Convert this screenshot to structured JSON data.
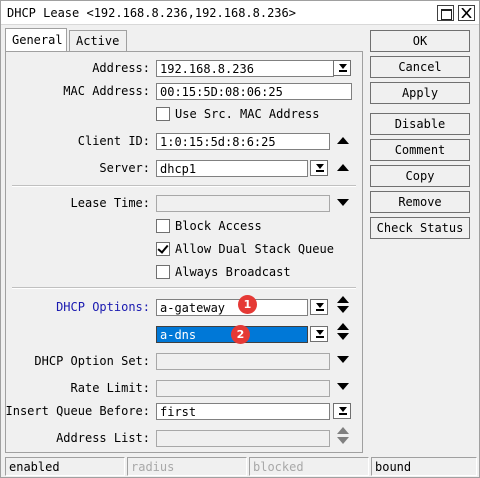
{
  "window": {
    "title": "DHCP Lease <192.168.8.236,192.168.8.236>"
  },
  "tabs": [
    {
      "label": "General",
      "active": true
    },
    {
      "label": "Active",
      "active": false
    }
  ],
  "form": {
    "address": {
      "label": "Address:",
      "value": "192.168.8.236"
    },
    "mac_address": {
      "label": "MAC Address:",
      "value": "00:15:5D:08:06:25"
    },
    "use_src_mac": {
      "label": "Use Src. MAC Address",
      "checked": false
    },
    "client_id": {
      "label": "Client ID:",
      "value": "1:0:15:5d:8:6:25"
    },
    "server": {
      "label": "Server:",
      "value": "dhcp1"
    },
    "lease_time": {
      "label": "Lease Time:",
      "value": ""
    },
    "block_access": {
      "label": "Block Access",
      "checked": false
    },
    "allow_dual_stack": {
      "label": "Allow Dual Stack Queue",
      "checked": true
    },
    "always_broadcast": {
      "label": "Always Broadcast",
      "checked": false
    },
    "dhcp_options": {
      "label": "DHCP Options:",
      "values": [
        "a-gateway",
        "a-dns"
      ]
    },
    "dhcp_option_set": {
      "label": "DHCP Option Set:",
      "value": ""
    },
    "rate_limit": {
      "label": "Rate Limit:",
      "value": ""
    },
    "insert_queue_before": {
      "label": "Insert Queue Before:",
      "value": "first"
    },
    "address_list": {
      "label": "Address List:",
      "value": ""
    }
  },
  "markers": [
    "1",
    "2"
  ],
  "buttons": [
    "OK",
    "Cancel",
    "Apply",
    "Disable",
    "Comment",
    "Copy",
    "Remove",
    "Check Status"
  ],
  "status": [
    "enabled",
    "radius",
    "blocked",
    "bound"
  ],
  "colors": {
    "selection": "#0078d7",
    "marker": "#e53935",
    "options_label": "#1a1ab0"
  }
}
